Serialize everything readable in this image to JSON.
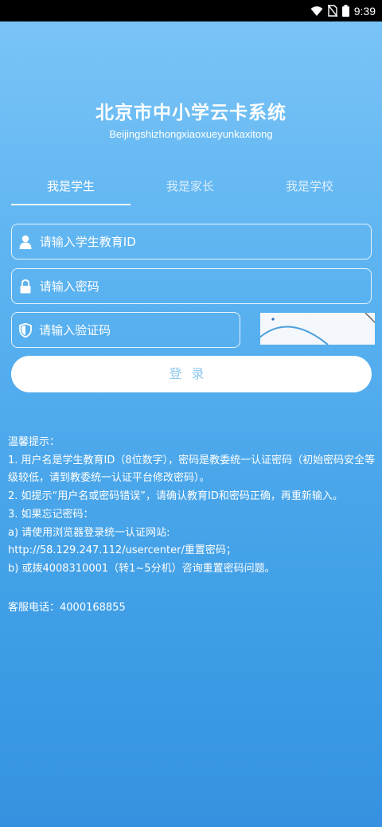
{
  "status_bar": {
    "time": "9:39",
    "icons": [
      "wifi-icon",
      "no-sim-icon",
      "battery-icon"
    ]
  },
  "app": {
    "title": "北京市中小学云卡系统",
    "subtitle": "Beijingshizhongxiaoxueyunkaxitong"
  },
  "tabs": [
    {
      "label": "我是学生",
      "active": true
    },
    {
      "label": "我是家长",
      "active": false
    },
    {
      "label": "我是学校",
      "active": false
    }
  ],
  "form": {
    "student_id_placeholder": "请输入学生教育ID",
    "password_placeholder": "请输入密码",
    "captcha_placeholder": "请输入验证码",
    "login_label": "登录"
  },
  "tips": {
    "heading": "温馨提示：",
    "line1": "1. 用户名是学生教育ID（8位数字），密码是教委统一认证密码（初始密码安全等级较低，请到教委统一认证平台修改密码）。",
    "line2": "2. 如提示“用户名或密码错误”，请确认教育ID和密码正确，再重新输入。",
    "line3": "3. 如果忘记密码：",
    "line4": "a) 请使用浏览器登录统一认证网站:",
    "line5": "http://58.129.247.112/usercenter/重置密码；",
    "line6": "b) 或拨4008310001（转1~5分机）咨询重置密码问题。"
  },
  "service": {
    "text": "客服电话：4000168855"
  }
}
